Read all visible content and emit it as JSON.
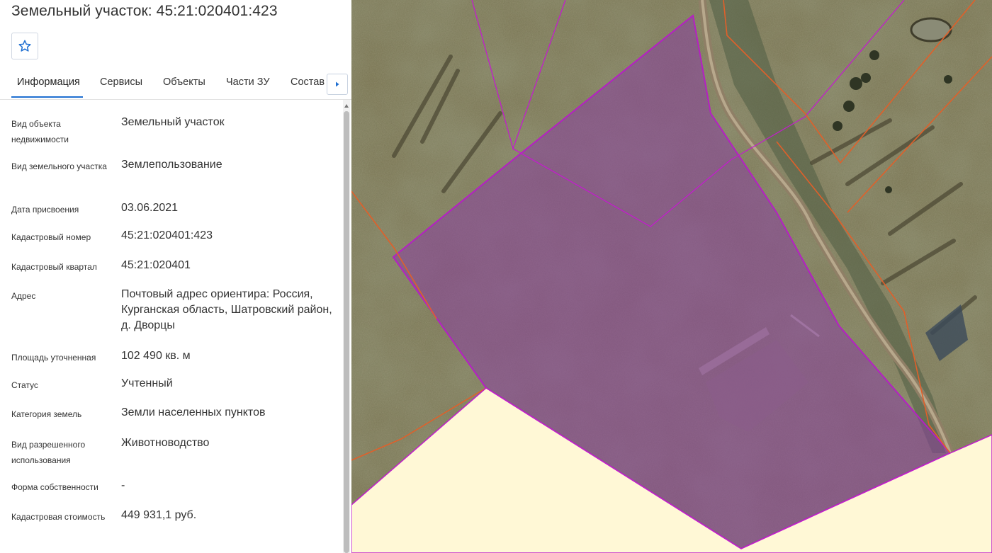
{
  "header": {
    "title": "Земельный участок: 45:21:020401:423"
  },
  "tabs": [
    {
      "label": "Информация",
      "active": true
    },
    {
      "label": "Сервисы",
      "active": false
    },
    {
      "label": "Объекты",
      "active": false
    },
    {
      "label": "Части ЗУ",
      "active": false
    },
    {
      "label": "Состав",
      "active": false
    }
  ],
  "fields": [
    {
      "label": "Вид объекта недвижимости",
      "value": "Земельный участок"
    },
    {
      "label": "Вид земельного участка",
      "value": "Землепользование"
    },
    {
      "label": "Дата присвоения",
      "value": "03.06.2021"
    },
    {
      "label": "Кадастровый номер",
      "value": "45:21:020401:423"
    },
    {
      "label": "Кадастровый квартал",
      "value": "45:21:020401"
    },
    {
      "label": "Адрес",
      "value": "Почтовый адрес ориентира: Россия, Курганская область, Шатровский район, д. Дворцы"
    },
    {
      "label": "Площадь уточненная",
      "value": "102 490 кв. м"
    },
    {
      "label": "Статус",
      "value": "Учтенный"
    },
    {
      "label": "Категория земель",
      "value": "Земли населенных пунктов"
    },
    {
      "label": "Вид разрешенного использования",
      "value": "Животноводство"
    },
    {
      "label": "Форма собственности",
      "value": "-"
    },
    {
      "label": "Кадастровая стоимость",
      "value": "449 931,1 руб."
    }
  ],
  "icons": {
    "favorite": "star-outline-icon",
    "tabs_next": "caret-right-icon"
  },
  "colors": {
    "accent": "#1f6fd1",
    "parcel_fill": "#8b3fa0",
    "parcel_border": "#b51fc4",
    "settlement_fill": "#fff8d6",
    "boundary_line": "#e0602a"
  }
}
